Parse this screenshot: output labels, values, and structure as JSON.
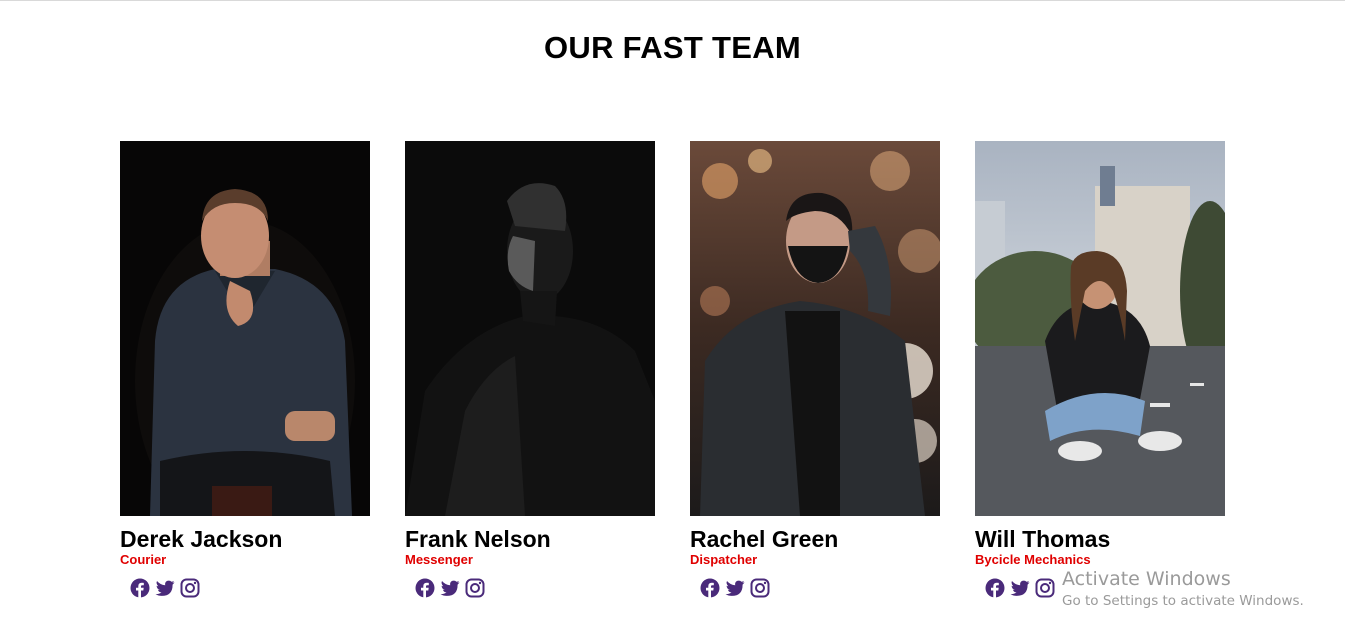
{
  "page": {
    "title": "OUR FAST TEAM"
  },
  "team": [
    {
      "name": "Derek Jackson",
      "role": "Courier"
    },
    {
      "name": "Frank Nelson",
      "role": "Messenger"
    },
    {
      "name": "Rachel Green",
      "role": "Dispatcher"
    },
    {
      "name": "Will Thomas",
      "role": "Bycicle Mechanics"
    }
  ],
  "social_icons": [
    "facebook-icon",
    "twitter-icon",
    "instagram-icon"
  ],
  "colors": {
    "accent": "#e00000",
    "icon": "#4a2a7a",
    "text": "#000000"
  },
  "watermark": {
    "title": "Activate Windows",
    "subtitle": "Go to Settings to activate Windows."
  }
}
